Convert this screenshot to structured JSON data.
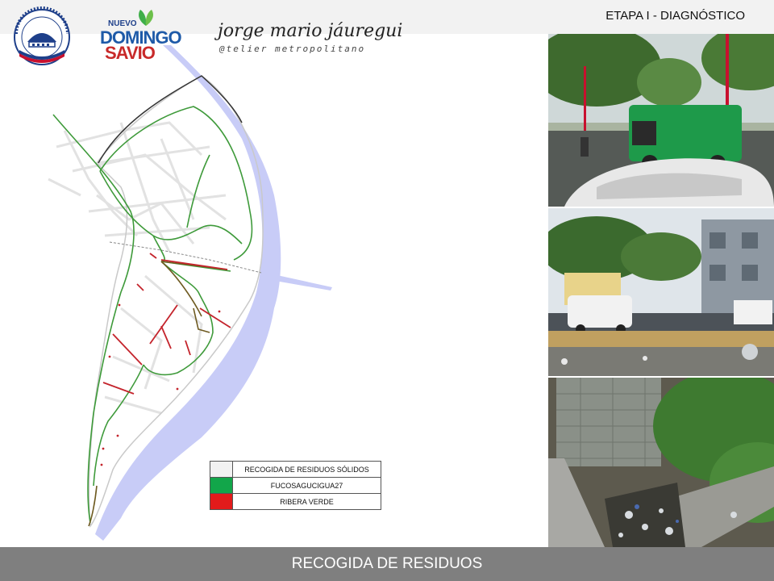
{
  "header": {
    "stage": "ETAPA I - DIAGNÓSTICO",
    "logo_seal_text": "PRESIDENCIA DE LA REPÚBLICA DOMINICANA",
    "brand_line1": "NUEVO",
    "brand_line2": "DOMINGO",
    "brand_line3": "SAVIO",
    "author": "jorge mario jáuregui",
    "author_sub": "@telier metropolitano"
  },
  "legend": {
    "title": "RECOGIDA DE RESIDUOS SÓLIDOS",
    "items": [
      {
        "label": "FUCOSAGUCIGUA27",
        "color": "#12a64a"
      },
      {
        "label": "RIBERA VERDE",
        "color": "#e21b1b"
      }
    ]
  },
  "colors": {
    "river": "#c8ccf7",
    "route_green": "#3e9a3a",
    "route_red": "#c4242c",
    "route_brown": "#6e5a20"
  },
  "footer": {
    "title": "RECOGIDA DE RESIDUOS"
  }
}
